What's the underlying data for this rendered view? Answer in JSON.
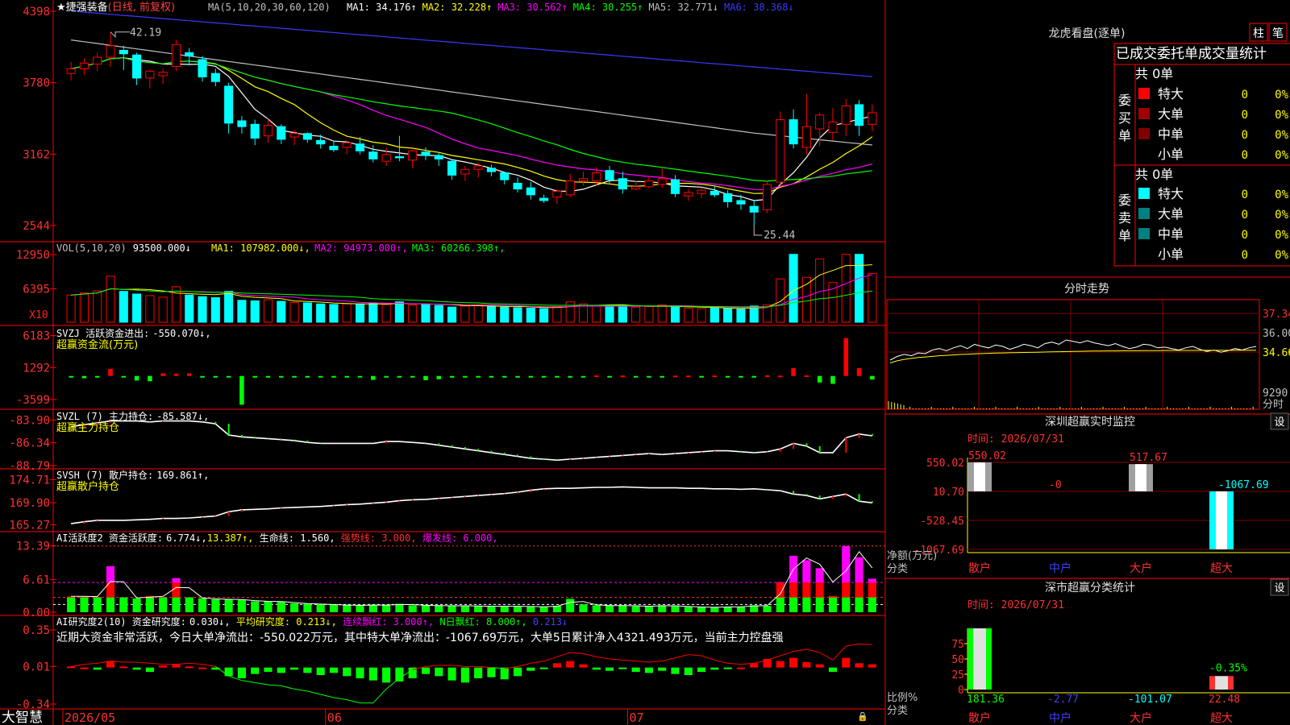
{
  "stock": {
    "name": "捷强装备",
    "mode": "(日线, 前复权)"
  },
  "main_panel": {
    "ma_label": "MA(5,10,20,30,60,120)",
    "items": [
      {
        "label": "MA1:",
        "value": "34.176",
        "arrow": "↑",
        "color": "#ffffff"
      },
      {
        "label": "MA2:",
        "value": "32.228",
        "arrow": "↑",
        "color": "#ffff00"
      },
      {
        "label": "MA3:",
        "value": "30.562",
        "arrow": "↑",
        "color": "#ff00ff"
      },
      {
        "label": "MA4:",
        "value": "30.255",
        "arrow": "↑",
        "color": "#00ff00"
      },
      {
        "label": "MA5:",
        "value": "32.771",
        "arrow": "↓",
        "color": "#c0c0c0"
      },
      {
        "label": "MA6:",
        "value": "38.368",
        "arrow": "↓",
        "color": "#3a3aff"
      }
    ],
    "y_ticks": [
      "4398",
      "3780",
      "3162",
      "2544"
    ],
    "hi_label": "42.19",
    "lo_label": "25.44"
  },
  "vol_panel": {
    "header": "VOL(5,10,20)",
    "value": "93500.000",
    "arrow": "↓",
    "items": [
      {
        "label": "MA1:",
        "value": "107982.000",
        "arrow": "↓",
        "color": "#ffff00"
      },
      {
        "label": "MA2:",
        "value": "94973.000",
        "arrow": "↑",
        "color": "#ff00ff"
      },
      {
        "label": "MA3:",
        "value": "60266.398",
        "arrow": "↑",
        "color": "#00ff00"
      }
    ],
    "y_ticks": [
      "12950",
      "6395"
    ],
    "unit": "X10"
  },
  "svzj_panel": {
    "header": "SVZJ  活跃资金进出:",
    "value": "-550.070",
    "arrow": "↓",
    "sub": "超赢资金流(万元)",
    "y_ticks": [
      "6183",
      "1292",
      "-3599"
    ]
  },
  "svzl_panel": {
    "header": "SVZL (7) 主力持仓:",
    "value": "-85.587",
    "arrow": "↓",
    "sub": "超赢主力持仓",
    "y_ticks": [
      "-83.90",
      "-86.34",
      "-88.79"
    ]
  },
  "svsh_panel": {
    "header": "SVSH (7) 散户持仓:",
    "value": "169.861",
    "arrow": "↑",
    "sub": "超赢散户持仓",
    "y_ticks": [
      "174.71",
      "169.90",
      "165.27"
    ]
  },
  "ai1_panel": {
    "header": "AI活跃度2 资金活跃度:",
    "value": "6.774",
    "arrow": "↓",
    "v2": "13.387",
    "life": "生命线: 1.560",
    "strong": "强势线: 3.000",
    "burst": "爆发线: 6.000",
    "y_ticks": [
      "13.39",
      "6.61",
      "0.00"
    ]
  },
  "ai2_panel": {
    "header": "AI研究度2(10) 资金研究度:",
    "value": "0.030",
    "arrow": "↓",
    "avg": "平均研究度: 0.213",
    "avg_arrow": "↓",
    "cont": "连续飘红: 3.000",
    "cont_arrow": "↑",
    "nday": "N日飘红: 8.000",
    "nday_arrow": "↑",
    "last": "0.213",
    "last_arrow": "↓",
    "summary": "近期大资金非常活跃，今日大单净流出：-550.022万元，其中特大单净流出：-1067.69万元，大单5日累计净入4321.493万元，当前主力控盘强",
    "y_ticks": [
      "0.35",
      "0.01",
      "-0.34"
    ]
  },
  "date_axis": {
    "brand": "大智慧",
    "labels": [
      "2026/05",
      "06",
      "07"
    ]
  },
  "right": {
    "lhb_title": "龙虎看盘(逐单)",
    "btn_bar": "柱",
    "btn_pen": "笔",
    "stats_title": "已成交委托单成交量统计",
    "buy_total": "共 0单",
    "buy_label": "委买单",
    "sell_total": "共 0单",
    "sell_label": "委卖单",
    "rows": [
      {
        "name": "特大",
        "count": "0",
        "pct": "0%"
      },
      {
        "name": "大单",
        "count": "0",
        "pct": "0%"
      },
      {
        "name": "中单",
        "count": "0",
        "pct": "0%"
      },
      {
        "name": "小单",
        "count": "0",
        "pct": "0%"
      }
    ],
    "fs_title": "分时走势",
    "fs_ticks": [
      "37.34",
      "36.00",
      "34.66",
      "9290"
    ],
    "fs_unit": "分时",
    "sz_title": "深圳超赢实时监控",
    "sz_settings": "设",
    "sz_time": "时间: 2026/07/31",
    "sz_y": [
      "550.02",
      "10.70",
      "-528.45",
      "-1067.69"
    ],
    "sz_ylabel": "净额(万元)",
    "sz_xlabel": "分类",
    "cls_title": "深市超赢分类统计",
    "cls_settings": "设",
    "cls_time": "时间: 2026/07/31",
    "cls_y": [
      "75",
      "50",
      "25",
      "0"
    ],
    "cls_ylabel": "比例%",
    "cls_xlabel": "分类",
    "categories": [
      "散户",
      "中户",
      "大户",
      "超大"
    ]
  },
  "chart_data": [
    {
      "type": "candlestick",
      "name": "捷强装备 日线",
      "dates_shown": [
        "2026/05",
        "06",
        "07"
      ],
      "ohlc": [
        [
          38.6,
          39.6,
          38.0,
          39.0
        ],
        [
          39.0,
          39.9,
          38.5,
          39.5
        ],
        [
          39.4,
          40.4,
          38.8,
          40.0
        ],
        [
          40.0,
          42.19,
          39.2,
          41.0
        ],
        [
          40.6,
          41.0,
          38.9,
          40.3
        ],
        [
          40.2,
          40.4,
          37.6,
          38.2
        ],
        [
          38.2,
          38.9,
          37.3,
          38.8
        ],
        [
          38.4,
          39.0,
          37.7,
          38.7
        ],
        [
          39.2,
          41.5,
          38.8,
          41.1
        ],
        [
          40.4,
          40.8,
          39.3,
          40.1
        ],
        [
          39.8,
          40.1,
          37.9,
          38.3
        ],
        [
          38.6,
          39.0,
          37.5,
          37.9
        ],
        [
          37.5,
          37.8,
          33.4,
          34.3
        ],
        [
          34.5,
          34.9,
          33.4,
          34.0
        ],
        [
          34.2,
          34.6,
          32.4,
          33.0
        ],
        [
          33.2,
          34.7,
          32.6,
          34.1
        ],
        [
          34.0,
          34.2,
          32.5,
          32.9
        ],
        [
          33.1,
          33.7,
          32.4,
          33.4
        ],
        [
          33.4,
          33.5,
          32.6,
          32.9
        ],
        [
          32.8,
          33.3,
          32.1,
          32.5
        ],
        [
          32.3,
          32.8,
          31.8,
          32.0
        ],
        [
          32.2,
          32.8,
          31.6,
          32.6
        ],
        [
          32.5,
          33.1,
          31.6,
          31.9
        ],
        [
          31.8,
          32.4,
          30.9,
          31.2
        ],
        [
          31.0,
          32.2,
          30.6,
          31.6
        ],
        [
          31.4,
          33.2,
          31.0,
          31.3
        ],
        [
          31.1,
          32.0,
          30.4,
          31.9
        ],
        [
          31.8,
          32.2,
          31.1,
          31.5
        ],
        [
          31.5,
          31.8,
          30.6,
          31.2
        ],
        [
          31.0,
          31.2,
          29.4,
          29.8
        ],
        [
          29.9,
          30.6,
          29.3,
          30.3
        ],
        [
          30.3,
          30.9,
          29.6,
          30.6
        ],
        [
          30.4,
          30.7,
          29.7,
          30.1
        ],
        [
          30.0,
          30.1,
          29.0,
          29.4
        ],
        [
          29.1,
          29.6,
          28.3,
          28.6
        ],
        [
          28.7,
          29.2,
          27.7,
          28.1
        ],
        [
          27.8,
          28.1,
          27.4,
          27.6
        ],
        [
          27.9,
          28.6,
          27.3,
          28.4
        ],
        [
          28.1,
          29.9,
          27.9,
          29.3
        ],
        [
          29.3,
          30.1,
          28.9,
          29.5
        ],
        [
          29.3,
          30.5,
          28.9,
          30.0
        ],
        [
          30.2,
          30.6,
          29.1,
          29.4
        ],
        [
          29.5,
          30.1,
          28.2,
          28.6
        ],
        [
          28.6,
          29.3,
          28.5,
          28.8
        ],
        [
          28.8,
          29.7,
          28.7,
          29.3
        ],
        [
          29.0,
          30.4,
          28.7,
          29.5
        ],
        [
          29.4,
          29.8,
          27.9,
          28.2
        ],
        [
          28.0,
          28.6,
          27.6,
          28.3
        ],
        [
          28.2,
          28.7,
          27.8,
          28.5
        ],
        [
          28.4,
          28.8,
          27.9,
          28.1
        ],
        [
          28.2,
          28.5,
          27.0,
          27.5
        ],
        [
          27.6,
          28.1,
          26.8,
          27.3
        ],
        [
          27.1,
          27.6,
          25.44,
          26.6
        ],
        [
          26.8,
          29.3,
          26.5,
          29.0
        ],
        [
          29.2,
          35.3,
          29.0,
          34.6
        ],
        [
          34.6,
          35.5,
          32.1,
          32.5
        ],
        [
          32.2,
          36.8,
          31.6,
          34.0
        ],
        [
          33.8,
          35.2,
          32.3,
          35.0
        ],
        [
          33.5,
          35.6,
          32.8,
          34.4
        ],
        [
          34.2,
          36.4,
          33.2,
          35.8
        ],
        [
          35.9,
          36.3,
          33.2,
          34.1
        ],
        [
          34.2,
          35.9,
          33.6,
          35.2
        ]
      ],
      "ma": [
        {
          "name": "MA1",
          "period": 5,
          "last": 34.176
        },
        {
          "name": "MA2",
          "period": 10,
          "last": 32.228
        },
        {
          "name": "MA3",
          "period": 20,
          "last": 30.562
        },
        {
          "name": "MA4",
          "period": 30,
          "last": 30.255
        },
        {
          "name": "MA5",
          "period": 60,
          "last": 32.771
        },
        {
          "name": "MA6",
          "period": 120,
          "last": 38.368
        }
      ],
      "y_range": [
        24.6,
        44.4
      ]
    },
    {
      "type": "bar",
      "name": "VOL",
      "unit_multiplier": 10,
      "values": [
        5200,
        5600,
        6000,
        8800,
        5900,
        5400,
        5100,
        4800,
        6800,
        5200,
        4900,
        4700,
        5900,
        4200,
        4100,
        4300,
        4000,
        3800,
        3700,
        3500,
        3400,
        3500,
        3500,
        3600,
        3400,
        3900,
        3300,
        3400,
        3200,
        2900,
        3100,
        3200,
        3100,
        2900,
        2800,
        2700,
        2600,
        3000,
        3900,
        3500,
        3200,
        3000,
        3100,
        2900,
        3000,
        3300,
        2900,
        2700,
        2600,
        2700,
        2600,
        2500,
        3100,
        3300,
        8300,
        13000,
        8600,
        12100,
        7600,
        13000,
        13000,
        9350
      ],
      "y_range": [
        0,
        14500
      ]
    },
    {
      "type": "bar",
      "name": "SVZJ 活跃资金进出",
      "values": [
        -200,
        -350,
        -150,
        1100,
        -150,
        -700,
        -800,
        400,
        350,
        400,
        -200,
        -200,
        -200,
        -4400,
        -250,
        -150,
        -150,
        -100,
        -100,
        -200,
        -200,
        -100,
        -150,
        -600,
        -200,
        -200,
        -200,
        -650,
        -500,
        -250,
        -150,
        -200,
        -150,
        -200,
        -200,
        -150,
        -100,
        -150,
        -100,
        -200,
        80,
        -150,
        70,
        -100,
        -120,
        -100,
        50,
        60,
        -100,
        70,
        -110,
        -80,
        -150,
        100,
        60,
        1200,
        90,
        -1000,
        -1200,
        5800,
        1200,
        -550
      ],
      "y_range": [
        -4600,
        7000
      ]
    },
    {
      "type": "line",
      "name": "SVZL 主力持仓",
      "values": [
        -84.6,
        -84.4,
        -84.2,
        -84.0,
        -84.0,
        -84.0,
        -84.1,
        -84.0,
        -84.0,
        -84.0,
        -84.1,
        -84.3,
        -85.5,
        -85.7,
        -85.8,
        -85.9,
        -86.0,
        -86.1,
        -86.3,
        -86.4,
        -86.4,
        -86.4,
        -86.4,
        -86.4,
        -86.2,
        -86.2,
        -86.3,
        -86.4,
        -86.6,
        -86.8,
        -87.0,
        -87.2,
        -87.4,
        -87.6,
        -87.8,
        -88.0,
        -88.1,
        -88.2,
        -88.1,
        -88.0,
        -87.9,
        -87.8,
        -87.7,
        -87.6,
        -87.5,
        -87.6,
        -87.5,
        -87.4,
        -87.3,
        -87.2,
        -87.2,
        -87.3,
        -87.4,
        -87.3,
        -87.0,
        -86.4,
        -86.7,
        -87.4,
        -87.4,
        -85.8,
        -85.4,
        -85.587
      ],
      "y_range": [
        -88.79,
        -83.6
      ]
    },
    {
      "type": "line",
      "name": "SVSH 散户持仓",
      "values": [
        165.5,
        165.9,
        166.2,
        166.2,
        166.2,
        166.3,
        166.4,
        166.6,
        166.6,
        166.7,
        166.9,
        167.1,
        168.0,
        168.4,
        168.5,
        168.6,
        168.8,
        168.9,
        169.0,
        169.1,
        169.3,
        169.5,
        169.6,
        169.8,
        170.0,
        170.3,
        170.5,
        170.6,
        170.8,
        171.0,
        171.2,
        171.4,
        171.6,
        171.8,
        172.1,
        172.5,
        172.8,
        172.9,
        172.9,
        173.0,
        173.1,
        173.1,
        173.2,
        173.1,
        173.0,
        173.0,
        173.0,
        172.9,
        172.9,
        172.8,
        172.8,
        172.7,
        172.8,
        172.6,
        172.4,
        171.7,
        171.4,
        170.7,
        171.2,
        171.7,
        170.2,
        169.861
      ],
      "y_range": [
        164.5,
        175.3
      ]
    },
    {
      "type": "bar",
      "name": "AI活跃度2 资金活跃度",
      "values": [
        3.2,
        3.2,
        3.1,
        9.3,
        3.0,
        2.8,
        3.3,
        3.1,
        6.9,
        3.0,
        2.8,
        2.6,
        2.6,
        2.5,
        2.2,
        2.2,
        2.1,
        1.8,
        1.7,
        1.6,
        1.5,
        1.4,
        1.4,
        1.5,
        1.4,
        1.7,
        1.4,
        1.4,
        1.3,
        1.3,
        1.3,
        1.2,
        1.2,
        1.2,
        1.2,
        1.1,
        1.1,
        1.3,
        2.7,
        1.6,
        1.4,
        1.3,
        1.4,
        1.2,
        1.2,
        1.4,
        1.2,
        1.1,
        1.0,
        1.0,
        1.1,
        1.1,
        1.4,
        1.3,
        6.1,
        11.4,
        10.5,
        8.9,
        3.3,
        13.387,
        11.1,
        6.774
      ],
      "lines": {
        "life": 1.56,
        "strong": 3.0,
        "burst": 6.0
      },
      "y_range": [
        0,
        14.0
      ]
    },
    {
      "type": "bar",
      "name": "AI研究度2 资金研究度",
      "values": [
        0.01,
        0.0,
        -0.02,
        0.06,
        0.01,
        -0.02,
        -0.04,
        0.02,
        0.03,
        0.01,
        0.0,
        -0.02,
        -0.08,
        -0.1,
        -0.06,
        -0.04,
        -0.05,
        -0.02,
        -0.05,
        -0.07,
        -0.05,
        -0.08,
        -0.1,
        -0.12,
        -0.14,
        -0.13,
        -0.1,
        -0.06,
        -0.08,
        -0.12,
        -0.14,
        -0.1,
        -0.09,
        -0.11,
        -0.08,
        -0.03,
        -0.01,
        0.04,
        0.06,
        0.03,
        -0.02,
        -0.03,
        -0.01,
        -0.04,
        -0.05,
        -0.03,
        -0.06,
        -0.07,
        -0.04,
        -0.02,
        -0.01,
        0.0,
        0.04,
        0.08,
        0.06,
        0.09,
        0.05,
        0.03,
        -0.04,
        0.09,
        0.04,
        0.03
      ],
      "avg_line": [
        0.01,
        0.03,
        0.04,
        0.06,
        0.05,
        0.05,
        0.04,
        0.03,
        0.03,
        0.04,
        0.03,
        0.01,
        -0.08,
        -0.12,
        -0.14,
        -0.16,
        -0.17,
        -0.2,
        -0.22,
        -0.25,
        -0.28,
        -0.3,
        -0.33,
        -0.33,
        -0.2,
        -0.1,
        -0.02,
        0.01,
        0.02,
        0.02,
        0.01,
        0.01,
        0.0,
        -0.01,
        0.01,
        0.04,
        0.06,
        0.1,
        0.14,
        0.13,
        0.1,
        0.08,
        0.07,
        0.06,
        0.05,
        0.06,
        0.09,
        0.12,
        0.11,
        0.07,
        0.04,
        0.03,
        0.04,
        0.07,
        0.11,
        0.15,
        0.17,
        0.14,
        0.07,
        0.2,
        0.22,
        0.213
      ],
      "y_range": [
        -0.34,
        0.35
      ]
    },
    {
      "type": "line",
      "name": "分时走势",
      "price": [
        34.1,
        34.35,
        34.5,
        34.4,
        34.6,
        34.55,
        34.8,
        34.9,
        34.75,
        34.95,
        35.1,
        34.9,
        35.2,
        35.05,
        34.95,
        35.15,
        35.05,
        34.85,
        35.0,
        35.2,
        35.1,
        34.95,
        35.25,
        35.35,
        35.2,
        35.5,
        35.4,
        35.3,
        35.45,
        35.3,
        35.2,
        35.1,
        35.25,
        35.05,
        34.9,
        35.0,
        35.2,
        35.15,
        34.95,
        35.0,
        34.9,
        34.8,
        34.95,
        35.05,
        34.85,
        34.7,
        34.8,
        34.65,
        34.75,
        34.9,
        34.8,
        34.95,
        35.05
      ],
      "avg": [
        33.9,
        34.05,
        34.15,
        34.22,
        34.28,
        34.32,
        34.36,
        34.4,
        34.43,
        34.46,
        34.49,
        34.51,
        34.53,
        34.55,
        34.57,
        34.59,
        34.6,
        34.61,
        34.62,
        34.63,
        34.64,
        34.65,
        34.66,
        34.67,
        34.68,
        34.69,
        34.7,
        34.71,
        34.72,
        34.73,
        34.73,
        34.74,
        34.74,
        34.75,
        34.75,
        34.75,
        34.76,
        34.76,
        34.76,
        34.77,
        34.77,
        34.77,
        34.77,
        34.77,
        34.78,
        34.78,
        34.78,
        34.78,
        34.78,
        34.78,
        34.79,
        34.79,
        34.79
      ],
      "y_range": [
        32.7,
        38.3
      ]
    },
    {
      "type": "bar",
      "name": "深圳超赢实时监控",
      "categories": [
        "散户",
        "中户",
        "大户",
        "超大"
      ],
      "values": [
        550.02,
        -0.0,
        517.67,
        -1067.69
      ],
      "labels": [
        "550.02",
        "-0",
        "517.67",
        "-1067.69"
      ],
      "y_range": [
        -1067.69,
        550.02
      ]
    },
    {
      "type": "bar",
      "name": "深市超赢分类统计",
      "categories": [
        "散户",
        "中户",
        "大户",
        "超大"
      ],
      "values": [
        181.36,
        -2.77,
        -101.07,
        22.48
      ],
      "percent": [
        100,
        0,
        0,
        22
      ],
      "labels": [
        "181.36",
        "-2.77",
        "-101.07",
        "22.48"
      ],
      "extra_label": "-0.35%",
      "y_range": [
        0,
        100
      ]
    }
  ]
}
